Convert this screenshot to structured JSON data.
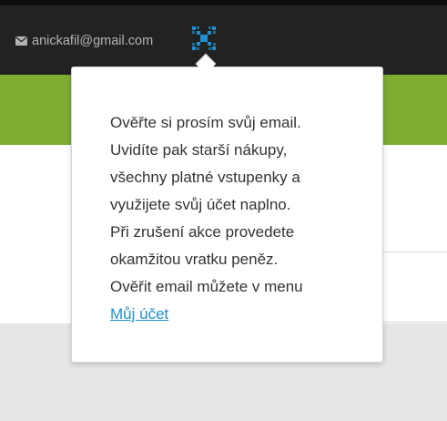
{
  "header": {
    "account_email": "anickafil@gmail.com",
    "account_icon": "envelope-icon",
    "logo_icon": "x-logo-icon",
    "colors": {
      "bar": "#222222",
      "logo": "#1e90d0",
      "accent_band": "#7dac2f"
    }
  },
  "popover": {
    "lines": [
      "Ověřte si prosím svůj email.",
      "Uvidíte pak starší nákupy,",
      "všechny platné vstupenky a",
      "využijete svůj účet naplno.",
      "Při zrušení akce provedete",
      "okamžitou vratku peněz.",
      "Ověřit email můžete v menu"
    ],
    "link_label": "Můj účet",
    "link_color": "#1e90d0"
  }
}
